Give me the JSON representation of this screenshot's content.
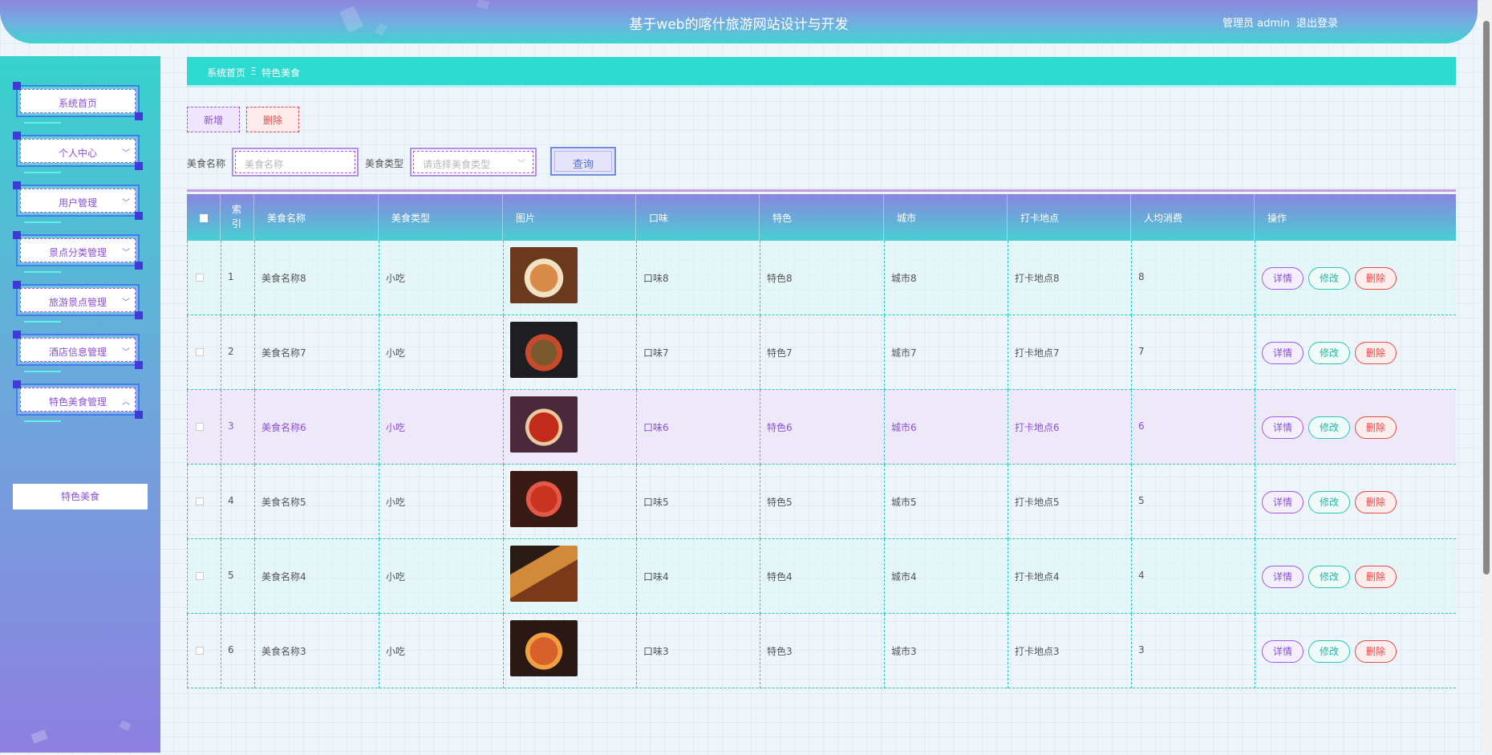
{
  "header": {
    "title": "基于web的喀什旅游网站设计与开发",
    "user": "管理员 admin",
    "logout": "退出登录"
  },
  "sidebar": {
    "items": [
      {
        "label": "系统首页",
        "chevron": ""
      },
      {
        "label": "个人中心",
        "chevron": "﹀"
      },
      {
        "label": "用户管理",
        "chevron": "﹀"
      },
      {
        "label": "景点分类管理",
        "chevron": "﹀"
      },
      {
        "label": "旅游景点管理",
        "chevron": "﹀"
      },
      {
        "label": "酒店信息管理",
        "chevron": "﹀"
      },
      {
        "label": "特色美食管理",
        "chevron": "︿"
      }
    ],
    "submenu": "特色美食"
  },
  "breadcrumb": {
    "home": "系统首页",
    "separator": "Ξ",
    "current": "特色美食"
  },
  "toolbar": {
    "add": "新增",
    "delete": "删除"
  },
  "search": {
    "name_label": "美食名称",
    "name_placeholder": "美食名称",
    "type_label": "美食类型",
    "type_placeholder": "请选择美食类型",
    "query": "查询"
  },
  "table": {
    "headers": {
      "index": "索\n引",
      "name": "美食名称",
      "type": "美食类型",
      "image": "图片",
      "taste": "口味",
      "feature": "特色",
      "city": "城市",
      "spot": "打卡地点",
      "cost": "人均消费",
      "ops": "操作"
    },
    "actions": {
      "detail": "详情",
      "edit": "修改",
      "remove": "删除"
    },
    "rows": [
      {
        "index": "1",
        "name": "美食名称8",
        "type": "小吃",
        "taste": "口味8",
        "feature": "特色8",
        "city": "城市8",
        "spot": "打卡地点8",
        "cost": "8"
      },
      {
        "index": "2",
        "name": "美食名称7",
        "type": "小吃",
        "taste": "口味7",
        "feature": "特色7",
        "city": "城市7",
        "spot": "打卡地点7",
        "cost": "7"
      },
      {
        "index": "3",
        "name": "美食名称6",
        "type": "小吃",
        "taste": "口味6",
        "feature": "特色6",
        "city": "城市6",
        "spot": "打卡地点6",
        "cost": "6"
      },
      {
        "index": "4",
        "name": "美食名称5",
        "type": "小吃",
        "taste": "口味5",
        "feature": "特色5",
        "city": "城市5",
        "spot": "打卡地点5",
        "cost": "5"
      },
      {
        "index": "5",
        "name": "美食名称4",
        "type": "小吃",
        "taste": "口味4",
        "feature": "特色4",
        "city": "城市4",
        "spot": "打卡地点4",
        "cost": "4"
      },
      {
        "index": "6",
        "name": "美食名称3",
        "type": "小吃",
        "taste": "口味3",
        "feature": "特色3",
        "city": "城市3",
        "spot": "打卡地点3",
        "cost": "3"
      }
    ]
  },
  "colors": {
    "accent": "#2ddad0",
    "purple": "#8d4fd8",
    "danger": "#e24a4a",
    "teal": "#2cb6a6"
  }
}
